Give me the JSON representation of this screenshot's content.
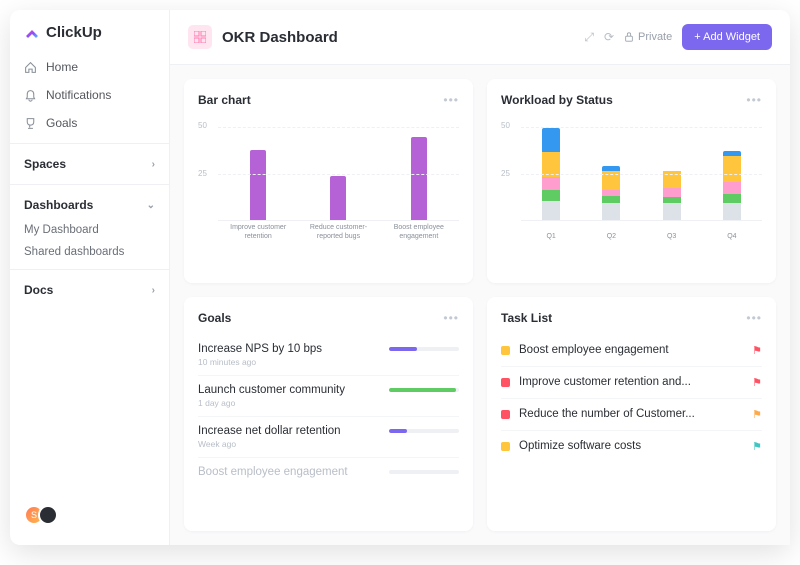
{
  "brand": "ClickUp",
  "sidebar": {
    "nav": [
      {
        "label": "Home"
      },
      {
        "label": "Notifications"
      },
      {
        "label": "Goals"
      }
    ],
    "spaces_label": "Spaces",
    "dashboards": {
      "label": "Dashboards",
      "items": [
        {
          "label": "My Dashboard"
        },
        {
          "label": "Shared dashboards"
        }
      ]
    },
    "docs_label": "Docs"
  },
  "header": {
    "title": "OKR Dashboard",
    "private_label": "Private",
    "add_widget": "+ Add Widget"
  },
  "cards": {
    "bar": {
      "title": "Bar chart"
    },
    "workload": {
      "title": "Workload by Status"
    },
    "goals": {
      "title": "Goals",
      "items": [
        {
          "name": "Increase NPS by 10 bps",
          "time": "10 minutes ago"
        },
        {
          "name": "Launch customer community",
          "time": "1 day ago"
        },
        {
          "name": "Increase net dollar retention",
          "time": "Week ago"
        },
        {
          "name": "Boost employee engagement",
          "time": ""
        }
      ]
    },
    "tasks": {
      "title": "Task List",
      "items": [
        {
          "name": "Boost employee engagement"
        },
        {
          "name": "Improve customer retention and..."
        },
        {
          "name": "Reduce the number of Customer..."
        },
        {
          "name": "Optimize software costs"
        }
      ]
    }
  },
  "chart_data": [
    {
      "type": "bar",
      "title": "Bar chart",
      "categories": [
        "Improve customer retention",
        "Reduce customer-reported bugs",
        "Boost employee engagement"
      ],
      "values": [
        38,
        24,
        45
      ],
      "ylim": [
        0,
        50
      ],
      "yticks": [
        25,
        50
      ],
      "color": "#b562d6"
    },
    {
      "type": "bar",
      "stacked": true,
      "title": "Workload by Status",
      "categories": [
        "Q1",
        "Q2",
        "Q3",
        "Q4"
      ],
      "series": [
        {
          "name": "gray",
          "color": "#dde2e8",
          "values": [
            10,
            9,
            9,
            9
          ]
        },
        {
          "name": "green",
          "color": "#5ecc62",
          "values": [
            6,
            4,
            3,
            5
          ]
        },
        {
          "name": "pink",
          "color": "#ff9dcf",
          "values": [
            7,
            3,
            5,
            6
          ]
        },
        {
          "name": "yellow",
          "color": "#ffc53d",
          "values": [
            13,
            10,
            9,
            14
          ]
        },
        {
          "name": "blue",
          "color": "#3498f0",
          "values": [
            13,
            3,
            0,
            3
          ]
        }
      ],
      "ylim": [
        0,
        50
      ],
      "yticks": [
        25,
        50
      ]
    }
  ],
  "goals_progress": [
    {
      "pct": 40,
      "color": "#7b68ee"
    },
    {
      "pct": 95,
      "color": "#5ecc62"
    },
    {
      "pct": 25,
      "color": "#7b68ee"
    },
    {
      "pct": 0,
      "color": "#7b68ee"
    }
  ],
  "task_colors": [
    {
      "sq": "#ffc53d",
      "flag": "red"
    },
    {
      "sq": "#ff5263",
      "flag": "red"
    },
    {
      "sq": "#ff5263",
      "flag": "orange"
    },
    {
      "sq": "#ffc53d",
      "flag": "teal"
    }
  ]
}
